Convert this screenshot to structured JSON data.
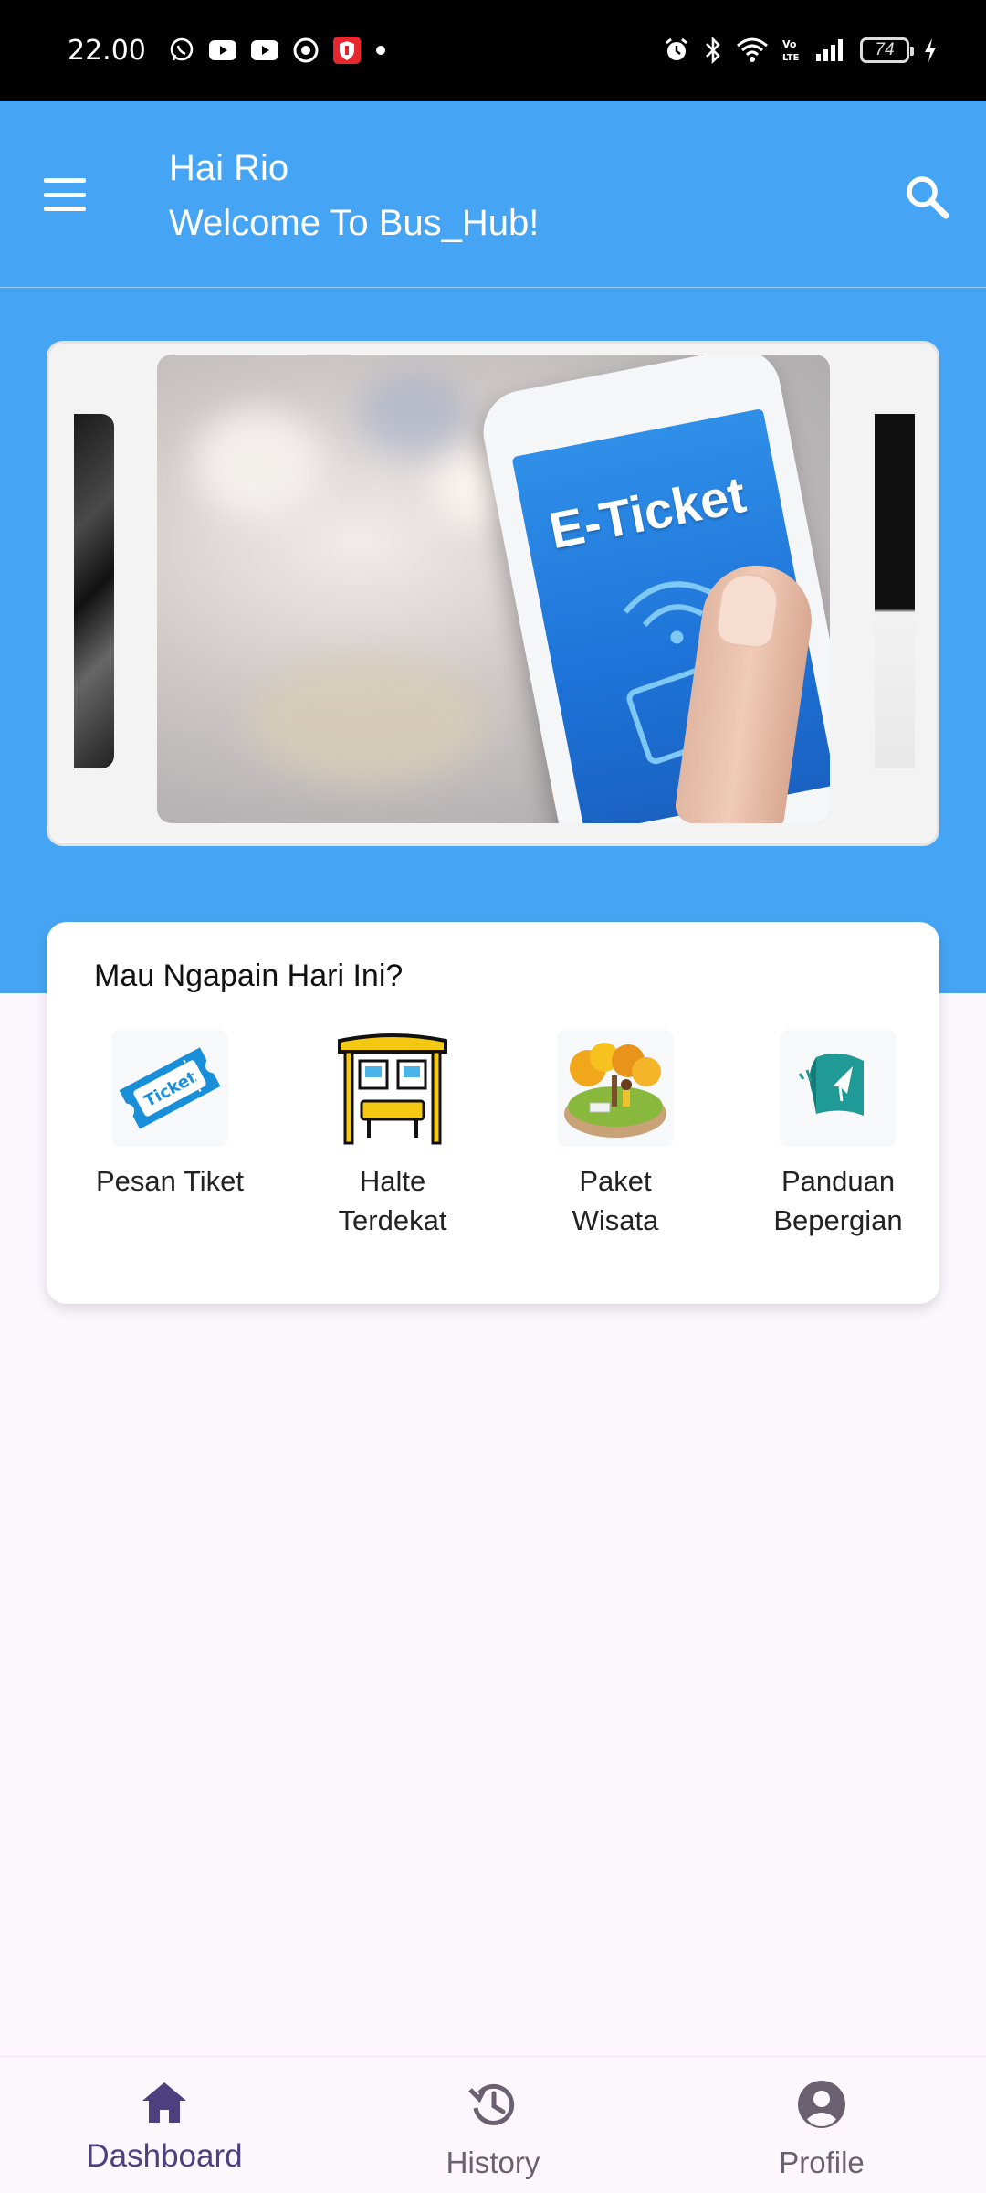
{
  "status_bar": {
    "time": "22.00",
    "battery": "74",
    "icons_left": [
      "whatsapp-icon",
      "youtube-icon",
      "youtube-icon",
      "app-icon",
      "shield-app-icon",
      "dot-icon"
    ],
    "icons_right": [
      "alarm-icon",
      "bluetooth-icon",
      "wifi-icon",
      "volte-icon",
      "signal-icon",
      "battery-icon",
      "charging-icon"
    ]
  },
  "header": {
    "greeting_line1": "Hai Rio",
    "greeting_line2": "Welcome To Bus_Hub!",
    "menu_icon": "hamburger-menu-icon",
    "search_icon": "search-icon"
  },
  "carousel": {
    "main_slide_text": "E-Ticket"
  },
  "options": {
    "title": "Mau Ngapain Hari Ini?",
    "items": [
      {
        "label": "Pesan Tiket",
        "icon": "ticket-icon"
      },
      {
        "label": "Halte\nTerdekat",
        "icon": "bus-stop-icon"
      },
      {
        "label": "Paket\nWisata",
        "icon": "tour-package-icon"
      },
      {
        "label": "Panduan\nBepergian",
        "icon": "travel-guide-icon"
      }
    ]
  },
  "bottom_nav": {
    "items": [
      {
        "label": "Dashboard",
        "icon": "home-icon",
        "active": true
      },
      {
        "label": "History",
        "icon": "history-icon",
        "active": false
      },
      {
        "label": "Profile",
        "icon": "account-circle-icon",
        "active": false
      }
    ]
  },
  "colors": {
    "primary": "#45a5f4",
    "background": "#fcf6fd",
    "nav_active": "#4e3f7f",
    "nav_inactive": "#6b6070"
  }
}
